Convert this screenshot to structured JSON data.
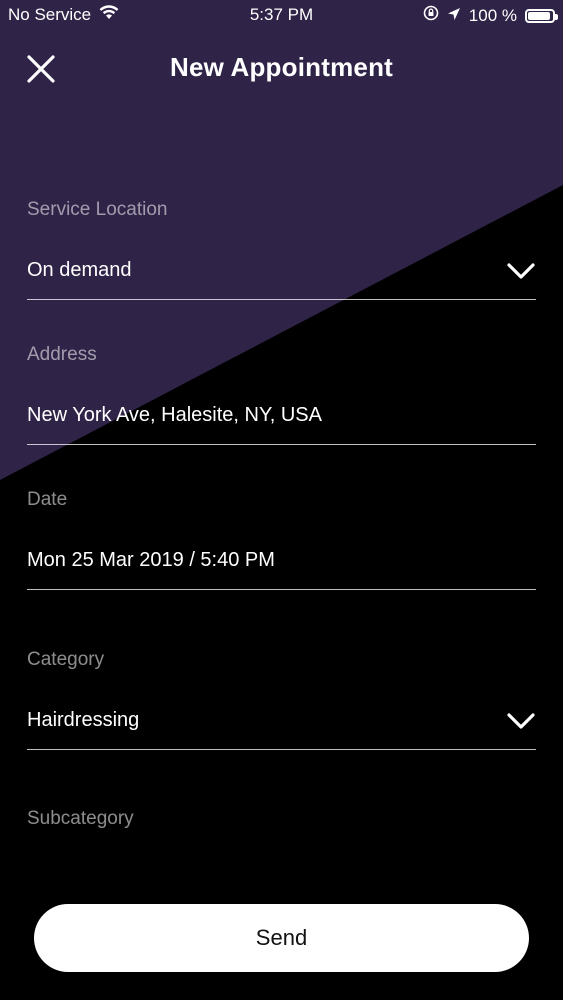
{
  "status_bar": {
    "carrier": "No Service",
    "time": "5:37 PM",
    "battery_percent": "100 %",
    "battery_level": 1.0
  },
  "header": {
    "title": "New Appointment",
    "close_icon": "close-icon"
  },
  "form": {
    "service_location": {
      "label": "Service Location",
      "value": "On demand"
    },
    "address": {
      "label": "Address",
      "value": "New York Ave, Halesite, NY, USA"
    },
    "date": {
      "label": "Date",
      "value": "Mon 25 Mar 2019 / 5:40 PM"
    },
    "category": {
      "label": "Category",
      "value": "Hairdressing"
    },
    "subcategory": {
      "label": "Subcategory",
      "value": ""
    }
  },
  "send_label": "Send",
  "colors": {
    "background": "#000000",
    "accent_purple": "#2f2347",
    "button": "#ffffff"
  }
}
